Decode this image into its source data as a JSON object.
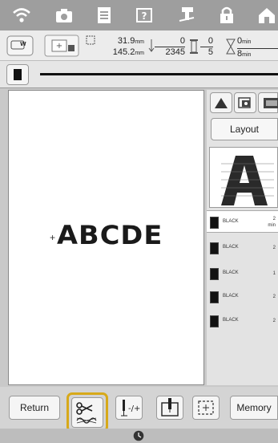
{
  "info": {
    "width": "31.9",
    "height": "145.2",
    "unit": "mm",
    "stitch_current": "0",
    "stitch_total": "2345",
    "color_current": "0",
    "color_total": "5",
    "time_current": "0",
    "time_total": "8",
    "time_unit": "min"
  },
  "canvas": {
    "design_text": "ABCDE"
  },
  "right_panel": {
    "layout_label": "Layout"
  },
  "threads": [
    {
      "name": "BLACK",
      "time": "2",
      "unit": "min",
      "color": "#111111"
    },
    {
      "name": "BLACK",
      "time": "2",
      "color": "#111111"
    },
    {
      "name": "BLACK",
      "time": "1",
      "color": "#111111"
    },
    {
      "name": "BLACK",
      "time": "2",
      "color": "#111111"
    },
    {
      "name": "BLACK",
      "time": "2",
      "color": "#111111"
    }
  ],
  "bottom": {
    "return_label": "Return",
    "memory_label": "Memory"
  },
  "colors": {
    "highlight": "#d7a91a",
    "topbar": "#9e9e9e"
  },
  "icons": [
    "wifi-icon",
    "camera-icon",
    "document-icon",
    "help-icon",
    "needle-icon",
    "lock-icon",
    "home-icon",
    "thread-cut-icon",
    "clock-icon"
  ]
}
